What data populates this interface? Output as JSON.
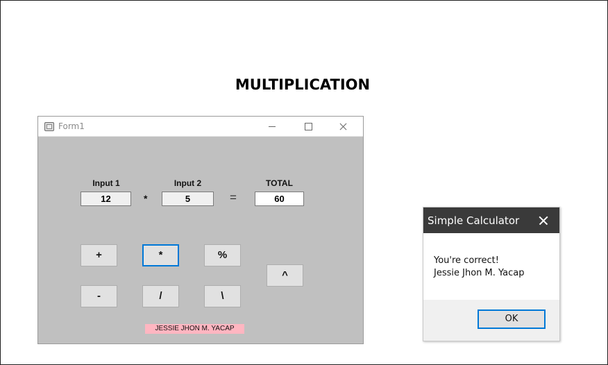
{
  "page": {
    "title": "MULTIPLICATION"
  },
  "form": {
    "title": "Form1",
    "input1": {
      "label": "Input 1",
      "value": "12"
    },
    "operator": "*",
    "input2": {
      "label": "Input 2",
      "value": "5"
    },
    "equals": "=",
    "total": {
      "label": "TOTAL",
      "value": "60"
    },
    "buttons": {
      "add": "+",
      "multiply": "*",
      "modulo": "%",
      "subtract": "-",
      "divide": "/",
      "int_divide": "\\",
      "power": "^"
    },
    "name_label": "JESSIE JHON M. YACAP"
  },
  "message_box": {
    "title": "Simple Calculator",
    "line1": "You're correct!",
    "line2": "Jessie Jhon M. Yacap",
    "ok_label": "OK"
  },
  "colors": {
    "form_background": "#c0c0c0",
    "name_label_background": "#ffb6c1",
    "focus_border": "#0078d7",
    "message_titlebar": "#3a3a3a"
  }
}
